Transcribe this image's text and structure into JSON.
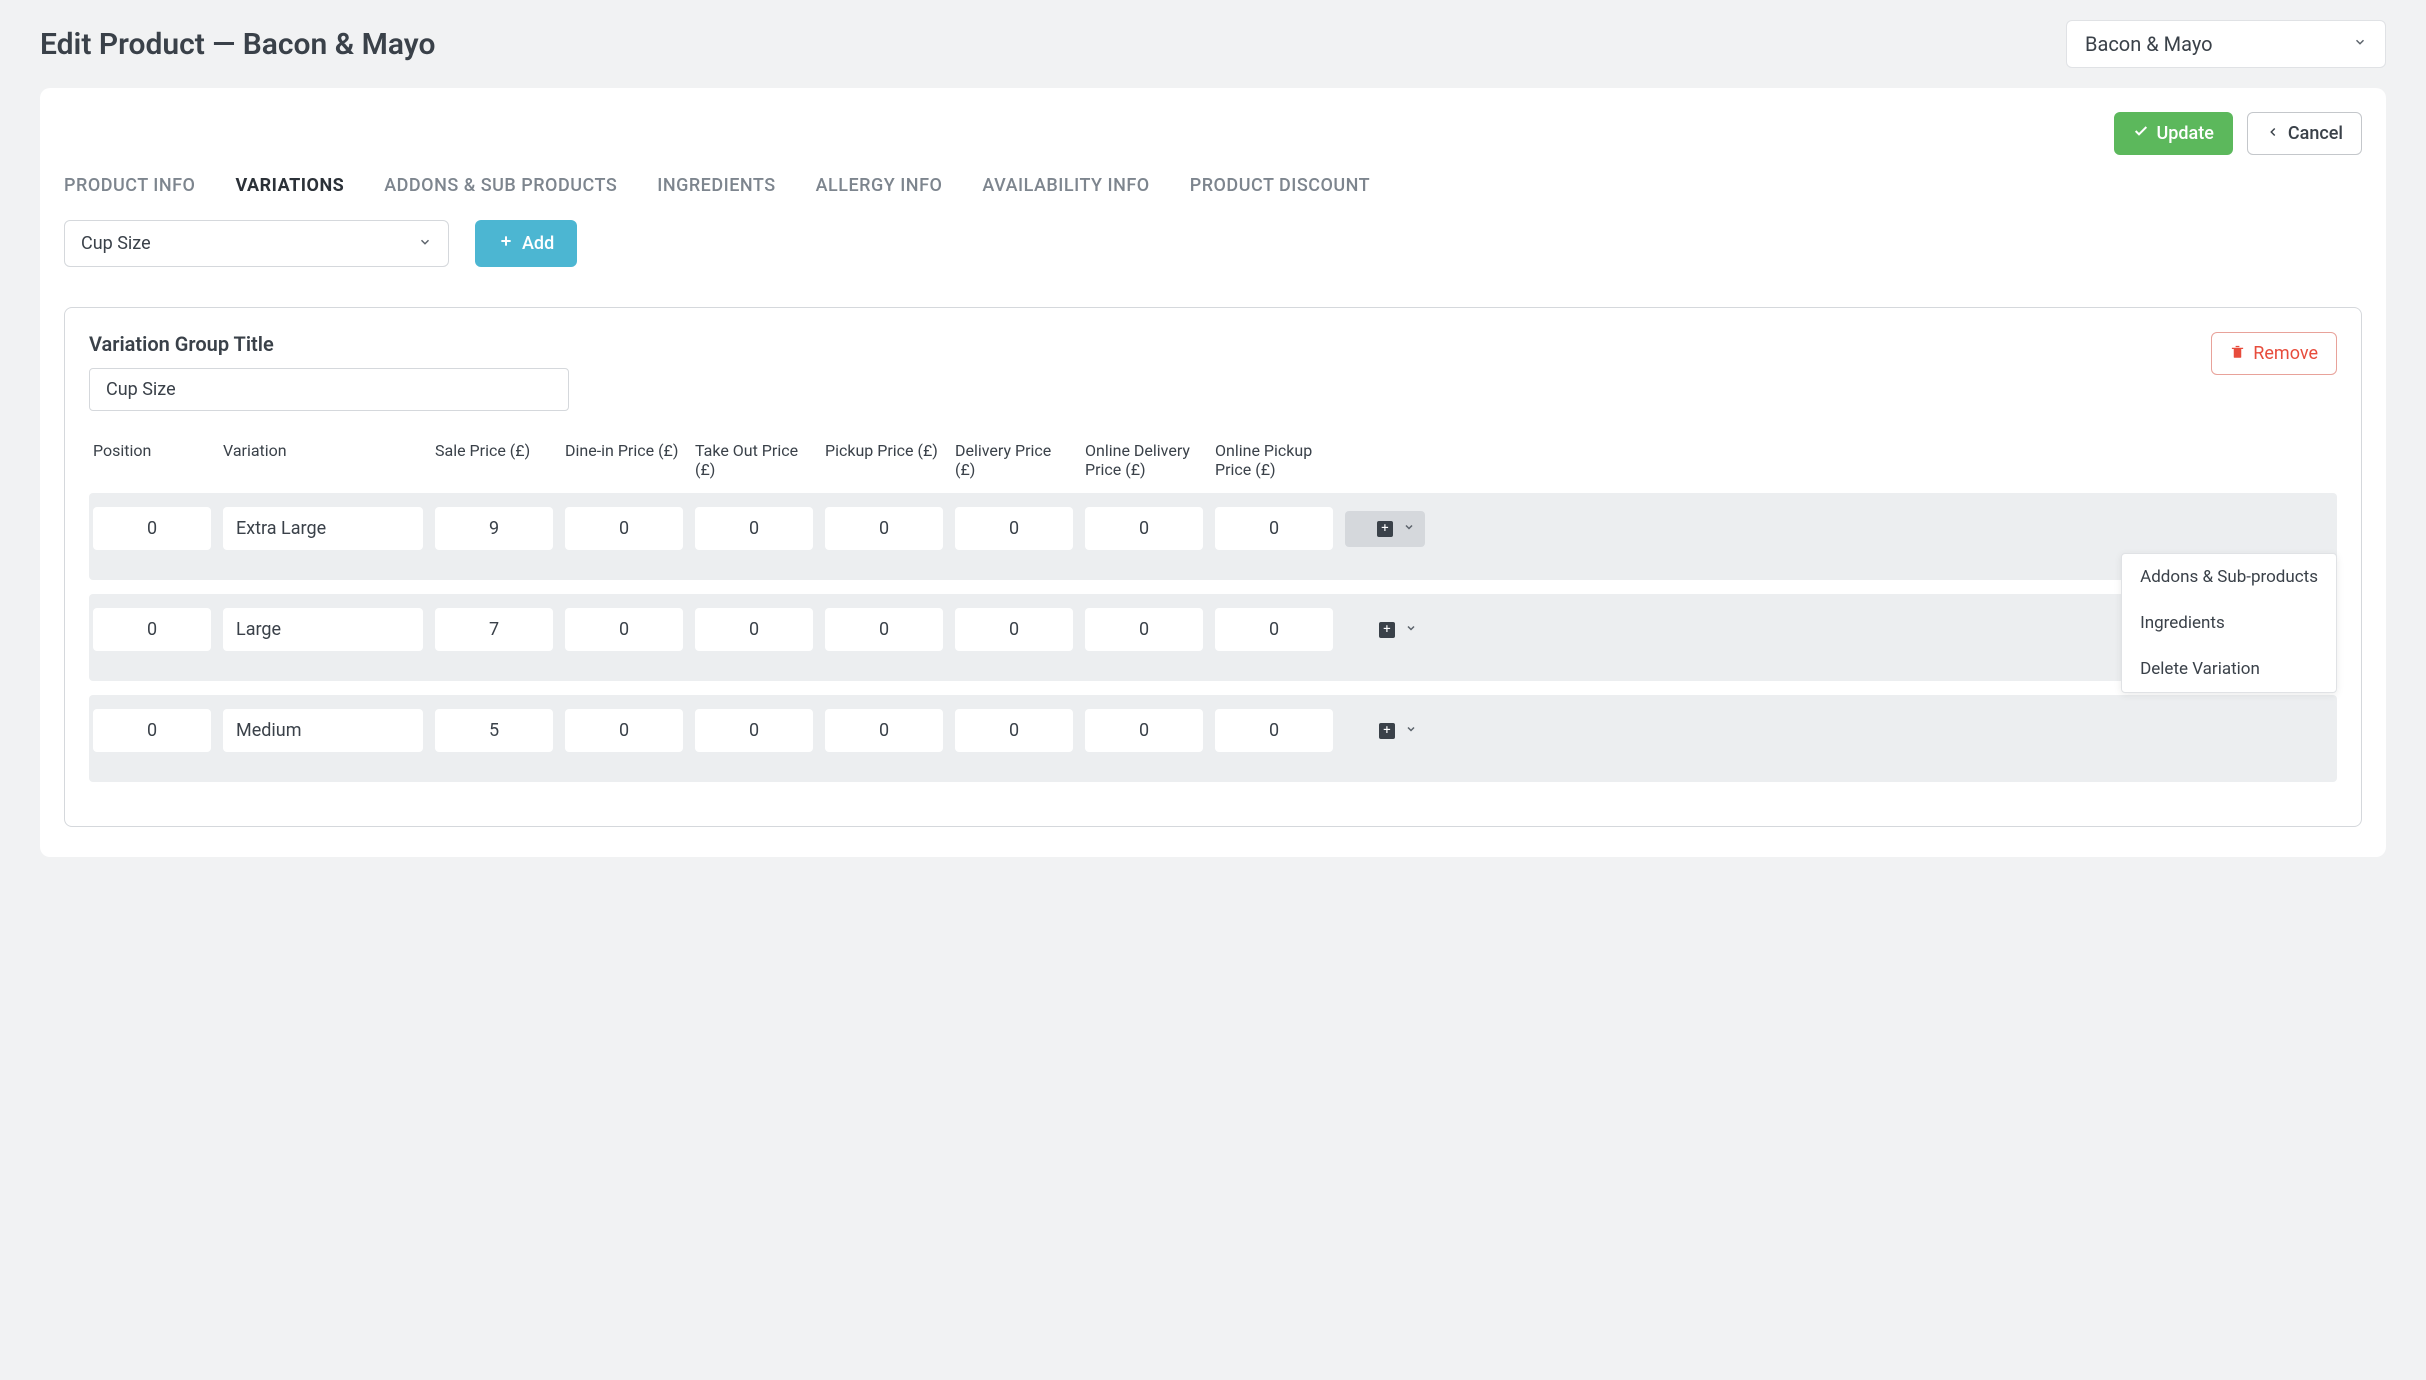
{
  "page_title": "Edit Product — Bacon & Mayo",
  "product_select": {
    "value": "Bacon & Mayo"
  },
  "actions": {
    "update": "Update",
    "cancel": "Cancel"
  },
  "tabs": [
    {
      "label": "PRODUCT INFO",
      "active": false
    },
    {
      "label": "VARIATIONS",
      "active": true
    },
    {
      "label": "ADDONS & SUB PRODUCTS",
      "active": false
    },
    {
      "label": "INGREDIENTS",
      "active": false
    },
    {
      "label": "ALLERGY INFO",
      "active": false
    },
    {
      "label": "AVAILABILITY INFO",
      "active": false
    },
    {
      "label": "PRODUCT DISCOUNT",
      "active": false
    }
  ],
  "filter": {
    "variation_type": "Cup Size",
    "add_label": "Add"
  },
  "group": {
    "title_label": "Variation Group Title",
    "title_value": "Cup Size",
    "remove_label": "Remove"
  },
  "columns": [
    "Position",
    "Variation",
    "Sale Price (£)",
    "Dine-in Price (£)",
    "Take Out Price (£)",
    "Pickup Price (£)",
    "Delivery Price (£)",
    "Online Delivery Price (£)",
    "Online Pickup Price (£)"
  ],
  "rows": [
    {
      "position": "0",
      "variation": "Extra Large",
      "sale": "9",
      "dinein": "0",
      "takeout": "0",
      "pickup": "0",
      "delivery": "0",
      "online_delivery": "0",
      "online_pickup": "0",
      "menu_open": true
    },
    {
      "position": "0",
      "variation": "Large",
      "sale": "7",
      "dinein": "0",
      "takeout": "0",
      "pickup": "0",
      "delivery": "0",
      "online_delivery": "0",
      "online_pickup": "0",
      "menu_open": false
    },
    {
      "position": "0",
      "variation": "Medium",
      "sale": "5",
      "dinein": "0",
      "takeout": "0",
      "pickup": "0",
      "delivery": "0",
      "online_delivery": "0",
      "online_pickup": "0",
      "menu_open": false
    }
  ],
  "row_menu": [
    "Addons & Sub-products",
    "Ingredients",
    "Delete Variation"
  ]
}
